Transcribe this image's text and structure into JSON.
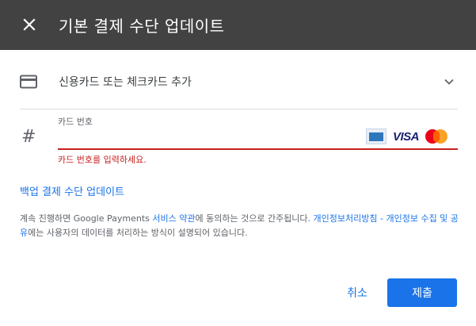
{
  "header": {
    "title": "기본 결제 수단 업데이트",
    "close_icon": "close-icon"
  },
  "payment_method": {
    "icon": "credit-card-icon",
    "label": "신용카드 또는 체크카드 추가",
    "expand_icon": "chevron-down-icon"
  },
  "card_number": {
    "icon": "hash-icon",
    "label": "카드 번호",
    "value": "",
    "error": "카드 번호를 입력하세요.",
    "brands": {
      "amex": "amex-logo",
      "visa": "VISA",
      "mastercard": "mastercard-logo"
    }
  },
  "backup_link": "백업 결제 수단 업데이트",
  "terms": {
    "prefix": "계속 진행하면 Google Payments ",
    "service_terms": "서비스 약관",
    "middle": "에 동의하는 것으로 간주됩니다. ",
    "privacy_link": "개인정보처리방침 - 개인정보 수집 및 공유",
    "suffix": "에는 사용자의 데이터를 처리하는 방식이 설명되어 있습니다."
  },
  "actions": {
    "cancel": "취소",
    "submit": "제출"
  },
  "colors": {
    "header_bg": "#424242",
    "accent": "#1a73e8",
    "error": "#c5221f"
  }
}
